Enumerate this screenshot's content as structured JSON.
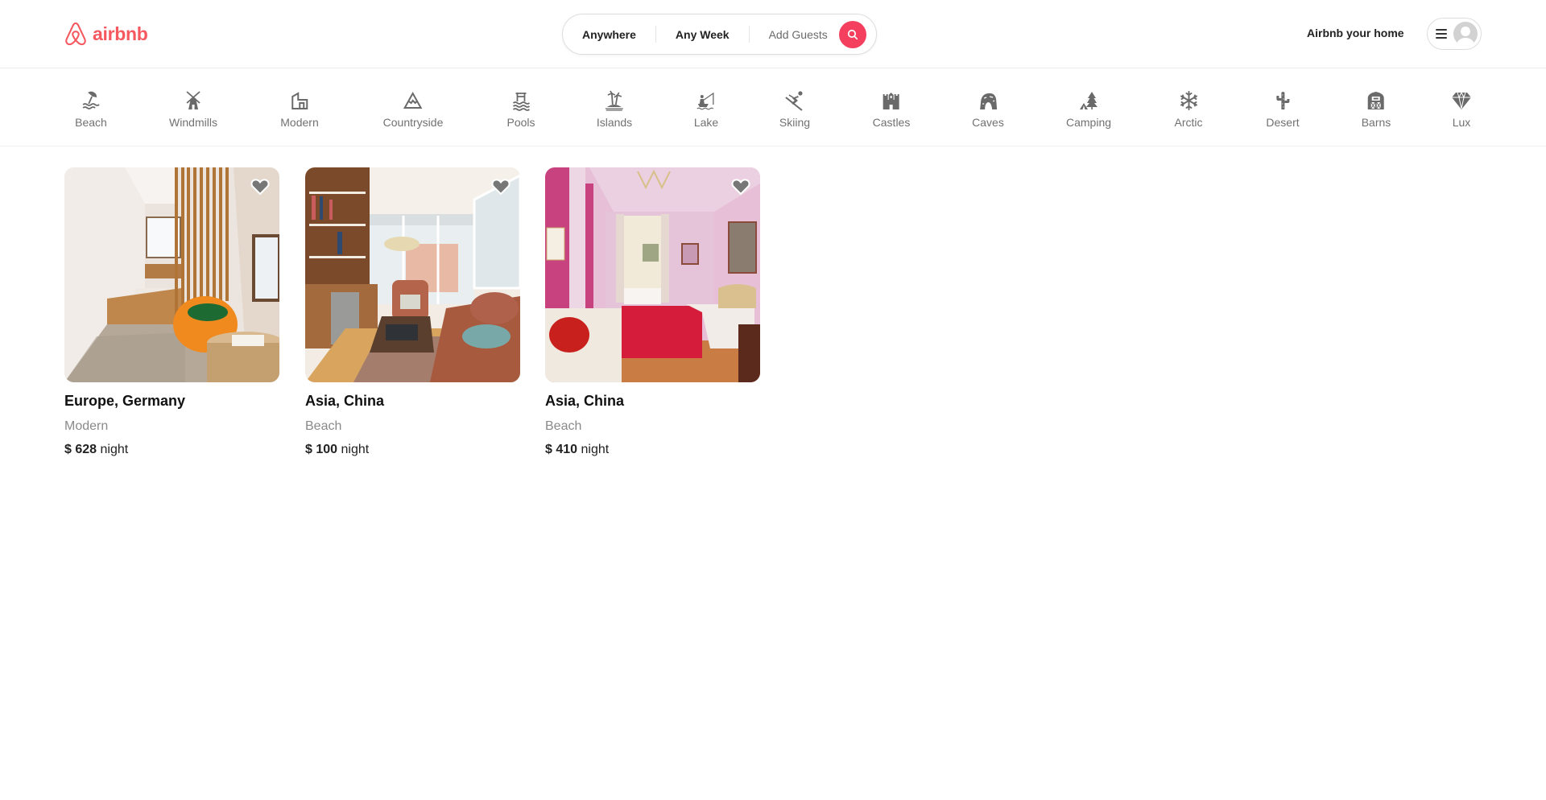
{
  "brand": {
    "name": "airbnb",
    "color": "#F5585F"
  },
  "search": {
    "location": "Anywhere",
    "dates": "Any Week",
    "guests": "Add Guests",
    "button_color": "#F43F5E",
    "button_icon": "search-icon"
  },
  "header": {
    "host_link": "Airbnb your home",
    "menu_icon": "hamburger-menu-icon",
    "avatar_icon": "user-avatar-icon"
  },
  "categories": [
    {
      "label": "Beach",
      "icon": "beach-umbrella-icon"
    },
    {
      "label": "Windmills",
      "icon": "windmill-icon"
    },
    {
      "label": "Modern",
      "icon": "modern-house-icon"
    },
    {
      "label": "Countryside",
      "icon": "mountain-icon"
    },
    {
      "label": "Pools",
      "icon": "pool-icon"
    },
    {
      "label": "Islands",
      "icon": "island-palm-icon"
    },
    {
      "label": "Lake",
      "icon": "fishing-boat-icon"
    },
    {
      "label": "Skiing",
      "icon": "skier-icon"
    },
    {
      "label": "Castles",
      "icon": "castle-icon"
    },
    {
      "label": "Caves",
      "icon": "cave-icon"
    },
    {
      "label": "Camping",
      "icon": "camping-tent-icon"
    },
    {
      "label": "Arctic",
      "icon": "snowflake-icon"
    },
    {
      "label": "Desert",
      "icon": "cactus-icon"
    },
    {
      "label": "Barns",
      "icon": "barn-icon"
    },
    {
      "label": "Lux",
      "icon": "diamond-icon"
    }
  ],
  "listings": [
    {
      "location": "Europe, Germany",
      "category": "Modern",
      "currency": "$",
      "price": "628",
      "unit": "night",
      "photo": "minimal bedroom with wooden slat divider and orange bean bag",
      "favorited": false
    },
    {
      "location": "Asia, China",
      "category": "Beach",
      "currency": "$",
      "price": "100",
      "unit": "night",
      "photo": "sunlit living room with leather sofas and bookshelves",
      "favorited": false
    },
    {
      "location": "Asia, China",
      "category": "Beach",
      "currency": "$",
      "price": "410",
      "unit": "night",
      "photo": "pink bedroom with red bedspread and chandelier",
      "favorited": false
    }
  ]
}
